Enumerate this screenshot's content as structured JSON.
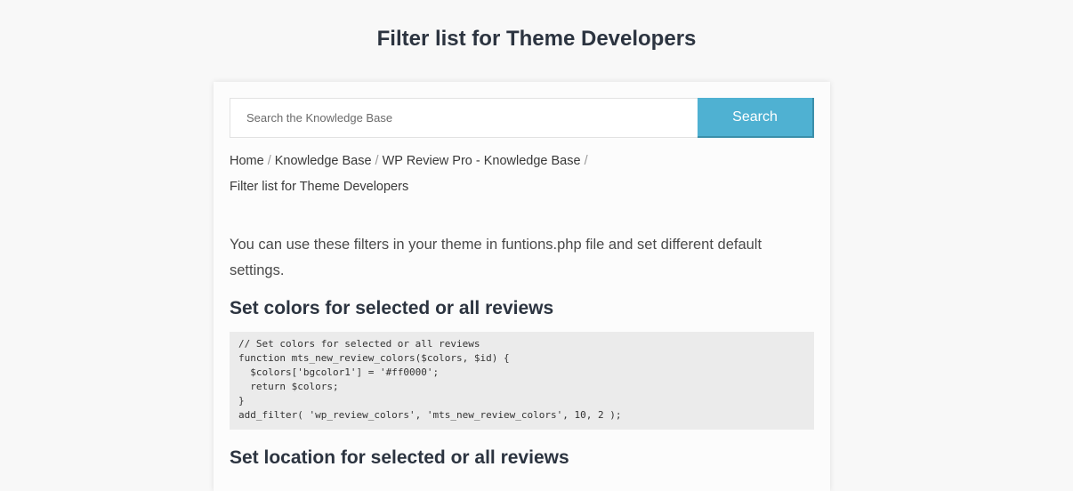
{
  "page": {
    "title": "Filter list for Theme Developers"
  },
  "search": {
    "placeholder": "Search the Knowledge Base",
    "button_label": "Search"
  },
  "breadcrumb": {
    "items": [
      "Home",
      "Knowledge Base",
      "WP Review Pro - Knowledge Base"
    ],
    "current": "Filter list for Theme Developers",
    "separator": "/"
  },
  "article": {
    "intro": "You can use these filters in your theme in funtions.php file and set different default settings.",
    "sections": [
      {
        "heading": "Set colors for selected or all reviews",
        "code": "// Set colors for selected or all reviews\nfunction mts_new_review_colors($colors, $id) {\n  $colors['bgcolor1'] = '#ff0000';\n  return $colors;\n}\nadd_filter( 'wp_review_colors', 'mts_new_review_colors', 10, 2 );"
      },
      {
        "heading": "Set location for selected or all reviews"
      }
    ]
  },
  "colors": {
    "accent": "#4fb1d2",
    "heading": "#2c3440",
    "code_bg": "#ebebeb"
  }
}
